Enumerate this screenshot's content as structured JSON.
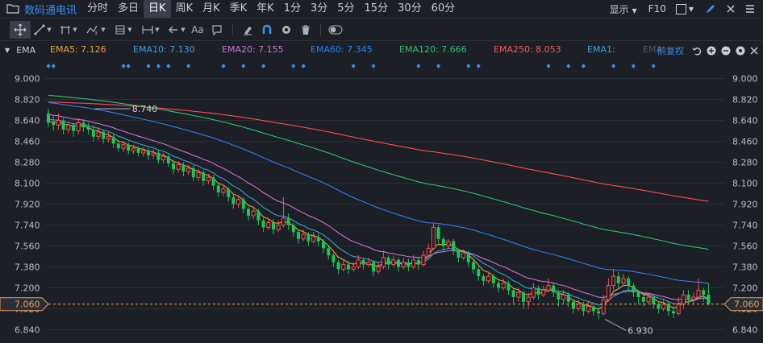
{
  "toolbar": {
    "brand_icon": "folder-icon",
    "brand": "数码通电讯",
    "tabs": [
      "分时",
      "多日",
      "日K",
      "周K",
      "月K",
      "季K",
      "年K",
      "1分",
      "3分",
      "5分",
      "15分",
      "30分",
      "60分"
    ],
    "active_tab": "日K",
    "display_label": "显示",
    "f10_label": "F10"
  },
  "tools": {
    "text_tool_label": "Aa"
  },
  "indicator_bar": {
    "name": "EMA",
    "fq_label": "前复权",
    "ema_items": [
      {
        "label": "EMA5: 7.126",
        "color": "#f0a040"
      },
      {
        "label": "EMA10: 7.130",
        "color": "#3aa0e0"
      },
      {
        "label": "EMA20: 7.155",
        "color": "#d070d0"
      },
      {
        "label": "EMA60: 7.345",
        "color": "#2f7ff0"
      },
      {
        "label": "EMA120: 7.666",
        "color": "#30c070"
      },
      {
        "label": "EMA250: 8.053",
        "color": "#f05a5a"
      },
      {
        "label": "EMA1:",
        "color": "#3aa0e0"
      },
      {
        "label": "EMA",
        "color": "#555a63"
      }
    ]
  },
  "colors": {
    "up": "#ff4d4f",
    "down": "#18c754",
    "background": "#1c1f26",
    "price_line": "#e8a060"
  },
  "chart_data": {
    "type": "candlestick",
    "yticks": [
      "9.000",
      "8.820",
      "8.640",
      "8.460",
      "8.280",
      "8.100",
      "7.920",
      "7.740",
      "7.560",
      "7.380",
      "7.200",
      "7.020",
      "6.840"
    ],
    "ylim": [
      6.84,
      9.0
    ],
    "current_price": "7.060",
    "annotations": [
      {
        "label": "8.740",
        "value": 8.74,
        "index": 9
      },
      {
        "label": "6.930",
        "value": 6.93,
        "index": 111
      }
    ],
    "candles": [
      [
        8.7,
        8.62,
        8.74,
        8.58
      ],
      [
        8.62,
        8.6,
        8.68,
        8.55
      ],
      [
        8.6,
        8.64,
        8.7,
        8.56
      ],
      [
        8.64,
        8.56,
        8.66,
        8.52
      ],
      [
        8.56,
        8.6,
        8.63,
        8.53
      ],
      [
        8.6,
        8.55,
        8.62,
        8.5
      ],
      [
        8.55,
        8.62,
        8.66,
        8.52
      ],
      [
        8.62,
        8.58,
        8.65,
        8.54
      ],
      [
        8.58,
        8.56,
        8.62,
        8.52
      ],
      [
        8.56,
        8.5,
        8.6,
        8.46
      ],
      [
        8.5,
        8.54,
        8.58,
        8.47
      ],
      [
        8.54,
        8.48,
        8.56,
        8.44
      ],
      [
        8.48,
        8.5,
        8.54,
        8.45
      ],
      [
        8.5,
        8.44,
        8.52,
        8.4
      ],
      [
        8.44,
        8.4,
        8.47,
        8.37
      ],
      [
        8.4,
        8.43,
        8.46,
        8.37
      ],
      [
        8.43,
        8.38,
        8.45,
        8.35
      ],
      [
        8.38,
        8.4,
        8.43,
        8.35
      ],
      [
        8.4,
        8.36,
        8.42,
        8.33
      ],
      [
        8.36,
        8.38,
        8.41,
        8.33
      ],
      [
        8.38,
        8.34,
        8.4,
        8.3
      ],
      [
        8.34,
        8.36,
        8.39,
        8.31
      ],
      [
        8.36,
        8.3,
        8.38,
        8.27
      ],
      [
        8.3,
        8.33,
        8.36,
        8.27
      ],
      [
        8.33,
        8.27,
        8.35,
        8.24
      ],
      [
        8.27,
        8.22,
        8.3,
        8.18
      ],
      [
        8.22,
        8.26,
        8.29,
        8.19
      ],
      [
        8.26,
        8.2,
        8.28,
        8.16
      ],
      [
        8.2,
        8.23,
        8.26,
        8.17
      ],
      [
        8.23,
        8.15,
        8.25,
        8.12
      ],
      [
        8.15,
        8.19,
        8.22,
        8.12
      ],
      [
        8.19,
        8.12,
        8.21,
        8.08
      ],
      [
        8.12,
        8.15,
        8.18,
        8.09
      ],
      [
        8.15,
        8.08,
        8.17,
        8.04
      ],
      [
        8.08,
        8.02,
        8.1,
        7.98
      ],
      [
        8.02,
        8.05,
        8.08,
        7.99
      ],
      [
        8.05,
        7.98,
        8.07,
        7.94
      ],
      [
        7.98,
        7.92,
        8.0,
        7.88
      ],
      [
        7.92,
        7.96,
        7.99,
        7.89
      ],
      [
        7.96,
        7.88,
        7.98,
        7.84
      ],
      [
        7.88,
        7.82,
        7.9,
        7.78
      ],
      [
        7.82,
        7.86,
        7.9,
        7.79
      ],
      [
        7.86,
        7.78,
        7.88,
        7.74
      ],
      [
        7.78,
        7.72,
        7.8,
        7.68
      ],
      [
        7.72,
        7.76,
        7.8,
        7.7
      ],
      [
        7.76,
        7.7,
        7.79,
        7.66
      ],
      [
        7.7,
        7.74,
        7.78,
        7.68
      ],
      [
        7.74,
        7.8,
        7.98,
        7.72
      ],
      [
        7.8,
        7.74,
        7.84,
        7.7
      ],
      [
        7.74,
        7.68,
        7.76,
        7.64
      ],
      [
        7.68,
        7.62,
        7.7,
        7.58
      ],
      [
        7.62,
        7.66,
        7.7,
        7.6
      ],
      [
        7.66,
        7.6,
        7.68,
        7.56
      ],
      [
        7.6,
        7.64,
        7.68,
        7.58
      ],
      [
        7.64,
        7.6,
        7.67,
        7.56
      ],
      [
        7.6,
        7.54,
        7.62,
        7.5
      ],
      [
        7.54,
        7.48,
        7.56,
        7.44
      ],
      [
        7.48,
        7.42,
        7.5,
        7.38
      ],
      [
        7.42,
        7.36,
        7.44,
        7.32
      ],
      [
        7.36,
        7.4,
        7.44,
        7.34
      ],
      [
        7.4,
        7.36,
        7.43,
        7.32
      ],
      [
        7.36,
        7.38,
        7.42,
        7.34
      ],
      [
        7.38,
        7.44,
        7.48,
        7.36
      ],
      [
        7.44,
        7.4,
        7.46,
        7.36
      ],
      [
        7.4,
        7.42,
        7.46,
        7.38
      ],
      [
        7.42,
        7.34,
        7.44,
        7.3
      ],
      [
        7.34,
        7.38,
        7.42,
        7.32
      ],
      [
        7.38,
        7.46,
        7.52,
        7.36
      ],
      [
        7.46,
        7.4,
        7.48,
        7.36
      ],
      [
        7.4,
        7.44,
        7.48,
        7.38
      ],
      [
        7.44,
        7.38,
        7.46,
        7.34
      ],
      [
        7.38,
        7.42,
        7.46,
        7.36
      ],
      [
        7.42,
        7.38,
        7.45,
        7.34
      ],
      [
        7.38,
        7.44,
        7.48,
        7.36
      ],
      [
        7.44,
        7.4,
        7.47,
        7.36
      ],
      [
        7.4,
        7.48,
        7.52,
        7.38
      ],
      [
        7.48,
        7.54,
        7.58,
        7.46
      ],
      [
        7.54,
        7.72,
        7.76,
        7.52
      ],
      [
        7.72,
        7.62,
        7.74,
        7.58
      ],
      [
        7.62,
        7.56,
        7.64,
        7.52
      ],
      [
        7.56,
        7.6,
        7.62,
        7.54
      ],
      [
        7.6,
        7.52,
        7.62,
        7.48
      ],
      [
        7.52,
        7.46,
        7.54,
        7.42
      ],
      [
        7.46,
        7.5,
        7.53,
        7.44
      ],
      [
        7.5,
        7.42,
        7.52,
        7.38
      ],
      [
        7.42,
        7.36,
        7.44,
        7.32
      ],
      [
        7.36,
        7.3,
        7.38,
        7.26
      ],
      [
        7.3,
        7.26,
        7.32,
        7.22
      ],
      [
        7.26,
        7.3,
        7.34,
        7.24
      ],
      [
        7.3,
        7.24,
        7.32,
        7.2
      ],
      [
        7.24,
        7.2,
        7.26,
        7.16
      ],
      [
        7.2,
        7.24,
        7.28,
        7.18
      ],
      [
        7.24,
        7.18,
        7.26,
        7.14
      ],
      [
        7.18,
        7.12,
        7.2,
        7.06
      ],
      [
        7.12,
        7.16,
        7.2,
        7.08
      ],
      [
        7.16,
        7.08,
        7.18,
        7.02
      ],
      [
        7.08,
        7.12,
        7.16,
        7.02
      ],
      [
        7.12,
        7.2,
        7.24,
        7.1
      ],
      [
        7.2,
        7.14,
        7.22,
        7.1
      ],
      [
        7.14,
        7.18,
        7.22,
        7.12
      ],
      [
        7.18,
        7.22,
        7.28,
        7.16
      ],
      [
        7.22,
        7.16,
        7.24,
        7.12
      ],
      [
        7.16,
        7.1,
        7.18,
        7.04
      ],
      [
        7.1,
        7.14,
        7.18,
        7.06
      ],
      [
        7.14,
        7.08,
        7.16,
        7.04
      ],
      [
        7.08,
        7.02,
        7.1,
        6.98
      ],
      [
        7.02,
        7.06,
        7.1,
        7.0
      ],
      [
        7.06,
        7.0,
        7.08,
        6.96
      ],
      [
        7.0,
        7.04,
        7.08,
        6.98
      ],
      [
        7.04,
        7.0,
        7.06,
        6.96
      ],
      [
        7.0,
        6.98,
        7.04,
        6.93
      ],
      [
        6.98,
        7.1,
        7.14,
        6.96
      ],
      [
        7.1,
        7.22,
        7.28,
        7.08
      ],
      [
        7.22,
        7.3,
        7.36,
        7.18
      ],
      [
        7.3,
        7.24,
        7.34,
        7.2
      ],
      [
        7.24,
        7.28,
        7.32,
        7.22
      ],
      [
        7.28,
        7.22,
        7.3,
        7.18
      ],
      [
        7.22,
        7.16,
        7.24,
        7.12
      ],
      [
        7.16,
        7.12,
        7.18,
        7.06
      ],
      [
        7.12,
        7.08,
        7.14,
        7.04
      ],
      [
        7.08,
        7.12,
        7.16,
        7.06
      ],
      [
        7.12,
        7.06,
        7.14,
        7.02
      ],
      [
        7.06,
        7.02,
        7.08,
        6.98
      ],
      [
        7.02,
        7.06,
        7.1,
        7.0
      ],
      [
        7.06,
        7.0,
        7.08,
        6.96
      ],
      [
        7.0,
        6.98,
        7.04,
        6.94
      ],
      [
        6.98,
        7.06,
        7.12,
        6.96
      ],
      [
        7.06,
        7.14,
        7.18,
        7.02
      ],
      [
        7.14,
        7.1,
        7.18,
        7.06
      ],
      [
        7.1,
        7.12,
        7.16,
        7.06
      ],
      [
        7.12,
        7.18,
        7.28,
        7.1
      ],
      [
        7.18,
        7.14,
        7.2,
        7.08
      ],
      [
        7.14,
        7.06,
        7.24,
        7.05
      ]
    ]
  }
}
